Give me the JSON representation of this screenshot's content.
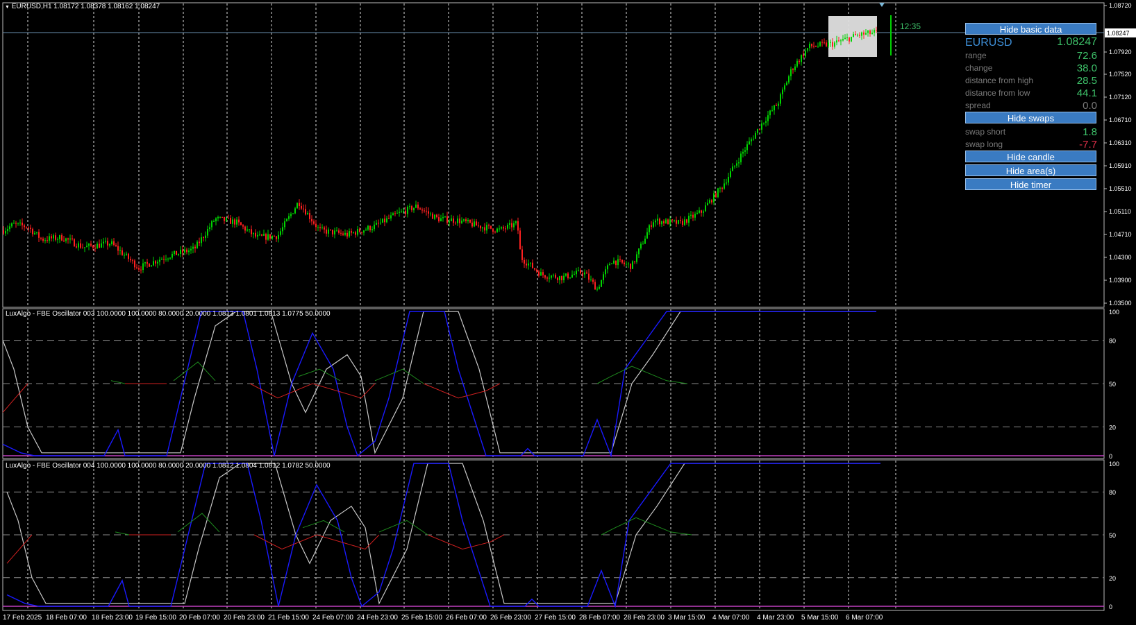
{
  "header": {
    "symbol_line": "EURUSD,H1  1.08172 1.08378 1.08162 1.08247",
    "osc1_line": "LuxAlgo - FBE Oscillator 003 100.0000 100.0000 80.0000 20.0000 1.0813 1.0801 1.0813 1.0775 50.0000",
    "osc2_line": "LuxAlgo - FBE Oscillator 004 100.0000 100.0000 80.0000 20.0000 1.0812 1.0804 1.0812 1.0782 50.0000"
  },
  "timer": "12:35",
  "price_axis": {
    "labels": [
      "1.08720",
      "1.08247",
      "1.07920",
      "1.07520",
      "1.07120",
      "1.06710",
      "1.06310",
      "1.05910",
      "1.05510",
      "1.05110",
      "1.04710",
      "1.04300",
      "1.03900",
      "1.03500"
    ],
    "current_price": "1.08247"
  },
  "osc_axis": {
    "labels": [
      "100",
      "80",
      "50",
      "20",
      "0"
    ]
  },
  "time_axis": {
    "labels": [
      "17 Feb 2025",
      "18 Feb 07:00",
      "18 Feb 23:00",
      "19 Feb 15:00",
      "20 Feb 07:00",
      "20 Feb 23:00",
      "21 Feb 15:00",
      "24 Feb 07:00",
      "24 Feb 23:00",
      "25 Feb 15:00",
      "26 Feb 07:00",
      "26 Feb 23:00",
      "27 Feb 15:00",
      "28 Feb 07:00",
      "28 Feb 23:00",
      "3 Mar 15:00",
      "4 Mar 07:00",
      "4 Mar 23:00",
      "5 Mar 15:00",
      "6 Mar 07:00"
    ]
  },
  "panel": {
    "hide_basic_data": "Hide basic data",
    "symbol": "EURUSD",
    "price": "1.08247",
    "rows": [
      {
        "label": "range",
        "value": "72.6",
        "color": "#3ec26a"
      },
      {
        "label": "change",
        "value": "38.0",
        "color": "#3ec26a"
      },
      {
        "label": "distance from high",
        "value": "28.5",
        "color": "#3ec26a"
      },
      {
        "label": "distance from low",
        "value": "44.1",
        "color": "#3ec26a"
      },
      {
        "label": "spread",
        "value": "0.0",
        "color": "#7a7a7a"
      }
    ],
    "hide_swaps": "Hide swaps",
    "swap_rows": [
      {
        "label": "swap short",
        "value": "1.8",
        "color": "#3ec26a"
      },
      {
        "label": "swap long",
        "value": "-7.7",
        "color": "#e0304a"
      }
    ],
    "hide_candle": "Hide candle",
    "hide_areas": "Hide area(s)",
    "hide_timer": "Hide timer"
  },
  "colors": {
    "bull": "#00d400",
    "bear": "#ff2020",
    "grid": "#d8d8d8",
    "osc_fast": "#1a1aff",
    "osc_slow": "#c8c8c8",
    "osc_mid_up": "#1e8a1e",
    "osc_mid_down": "#d02020",
    "osc_base": "#c040c0",
    "accent_button": "#3a7bc2"
  },
  "chart_data": {
    "type": "candlestick",
    "symbol": "EURUSD",
    "timeframe": "H1",
    "ylim": [
      1.035,
      1.0872
    ],
    "close_path": [
      {
        "x": 0,
        "close": 1.0475
      },
      {
        "x": 20,
        "close": 1.0488
      },
      {
        "x": 40,
        "close": 1.0484
      },
      {
        "x": 60,
        "close": 1.0462
      },
      {
        "x": 90,
        "close": 1.0465
      },
      {
        "x": 120,
        "close": 1.0448
      },
      {
        "x": 160,
        "close": 1.0455
      },
      {
        "x": 200,
        "close": 1.0412
      },
      {
        "x": 240,
        "close": 1.0432
      },
      {
        "x": 280,
        "close": 1.0445
      },
      {
        "x": 310,
        "close": 1.0498
      },
      {
        "x": 340,
        "close": 1.0492
      },
      {
        "x": 370,
        "close": 1.0465
      },
      {
        "x": 400,
        "close": 1.0468
      },
      {
        "x": 430,
        "close": 1.0528
      },
      {
        "x": 460,
        "close": 1.0478
      },
      {
        "x": 500,
        "close": 1.047
      },
      {
        "x": 540,
        "close": 1.0485
      },
      {
        "x": 570,
        "close": 1.0505
      },
      {
        "x": 600,
        "close": 1.052
      },
      {
        "x": 630,
        "close": 1.0498
      },
      {
        "x": 660,
        "close": 1.0495
      },
      {
        "x": 690,
        "close": 1.0485
      },
      {
        "x": 720,
        "close": 1.0478
      },
      {
        "x": 745,
        "close": 1.049
      },
      {
        "x": 750,
        "close": 1.043
      },
      {
        "x": 780,
        "close": 1.04
      },
      {
        "x": 810,
        "close": 1.0395
      },
      {
        "x": 840,
        "close": 1.0405
      },
      {
        "x": 860,
        "close": 1.0375
      },
      {
        "x": 880,
        "close": 1.0425
      },
      {
        "x": 910,
        "close": 1.0415
      },
      {
        "x": 940,
        "close": 1.0495
      },
      {
        "x": 980,
        "close": 1.049
      },
      {
        "x": 1010,
        "close": 1.051
      },
      {
        "x": 1040,
        "close": 1.0555
      },
      {
        "x": 1070,
        "close": 1.0615
      },
      {
        "x": 1100,
        "close": 1.067
      },
      {
        "x": 1120,
        "close": 1.07
      },
      {
        "x": 1140,
        "close": 1.076
      },
      {
        "x": 1165,
        "close": 1.08
      },
      {
        "x": 1200,
        "close": 1.0805
      },
      {
        "x": 1235,
        "close": 1.082
      },
      {
        "x": 1262,
        "close": 1.0825
      }
    ],
    "oscillator_levels": [
      0,
      20,
      50,
      80,
      100
    ]
  }
}
